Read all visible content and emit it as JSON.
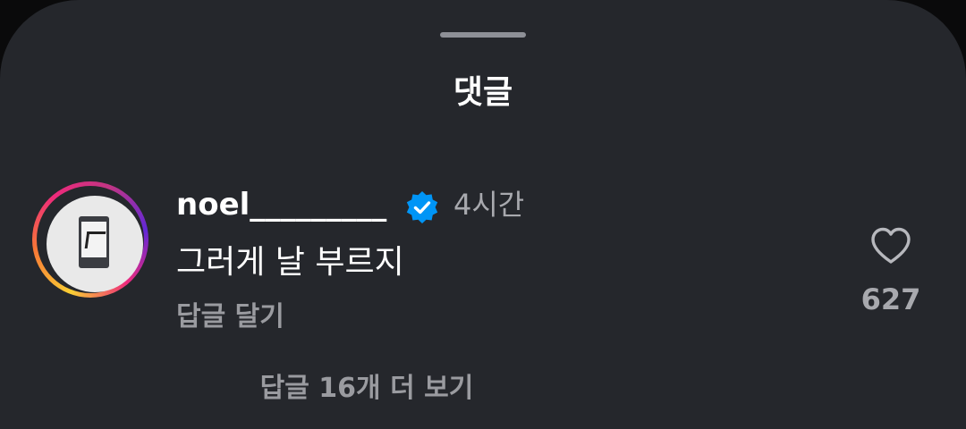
{
  "sheet": {
    "title": "댓글"
  },
  "comment": {
    "username": "noel_________",
    "verified": true,
    "time": "4시간",
    "text": "그러게 날 부르지",
    "reply_label": "답글 달기",
    "likes": "627",
    "view_replies_label": "답글 16개 더 보기"
  },
  "icons": {
    "handle": "drag-handle",
    "avatar": "profile-avatar",
    "verified": "verified-badge-icon",
    "like": "heart-icon"
  },
  "colors": {
    "background": "#25272c",
    "text_primary": "#ffffff",
    "text_secondary": "#a8a9ae",
    "verified_blue": "#0095f6"
  }
}
